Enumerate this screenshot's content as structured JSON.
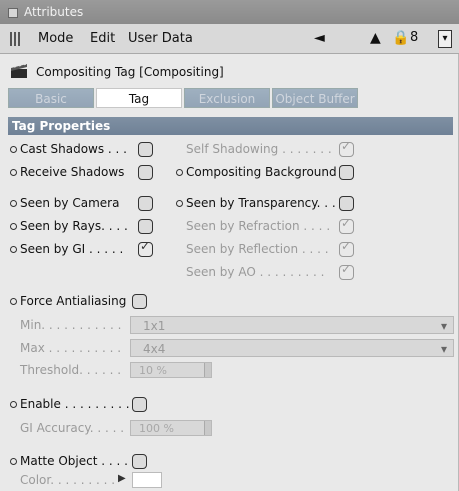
{
  "window": {
    "title": "Attributes"
  },
  "menubar": {
    "items": [
      "Mode",
      "Edit",
      "User Data"
    ],
    "lock_count": "8"
  },
  "object": {
    "title": "Compositing Tag [Compositing]"
  },
  "tabs": [
    {
      "label": "Basic",
      "active": false
    },
    {
      "label": "Tag",
      "active": true
    },
    {
      "label": "Exclusion",
      "active": false
    },
    {
      "label": "Object Buffer",
      "active": false
    }
  ],
  "section": {
    "title": "Tag Properties"
  },
  "left_options": [
    {
      "label": "Cast Shadows . . .",
      "checked": false
    },
    {
      "label": "Receive Shadows",
      "checked": false
    },
    {
      "label": "Seen by Camera",
      "checked": false
    },
    {
      "label": "Seen by Rays. . . .",
      "checked": false
    },
    {
      "label": "Seen by GI . . . . .",
      "checked": true
    }
  ],
  "right_options": [
    {
      "label": "Self Shadowing . . . . . . .",
      "checked": true,
      "dim": true
    },
    {
      "label": "Compositing Background",
      "checked": false,
      "dim": false
    },
    {
      "label": "Seen by Transparency. . .",
      "checked": false,
      "dim": false
    },
    {
      "label": "Seen by Refraction . . . .",
      "checked": true,
      "dim": true
    },
    {
      "label": "Seen by Reflection . . . .",
      "checked": true,
      "dim": true
    },
    {
      "label": "Seen by AO . . . . . . . . .",
      "checked": true,
      "dim": true
    }
  ],
  "antialias": {
    "label": "Force Antialiasing",
    "min_label": "Min. . . . . . . . . . .",
    "min_value": "1x1",
    "max_label": "Max . . . . . . . . . .",
    "max_value": "4x4",
    "threshold_label": "Threshold. . . . . .",
    "threshold_value": "10 %"
  },
  "gi": {
    "enable_label": "Enable . . . . . . . . .",
    "accuracy_label": "GI Accuracy. . . . .",
    "accuracy_value": "100 %"
  },
  "matte": {
    "label": "Matte Object . . . .",
    "color_label": "Color. . . . . . . . ."
  }
}
